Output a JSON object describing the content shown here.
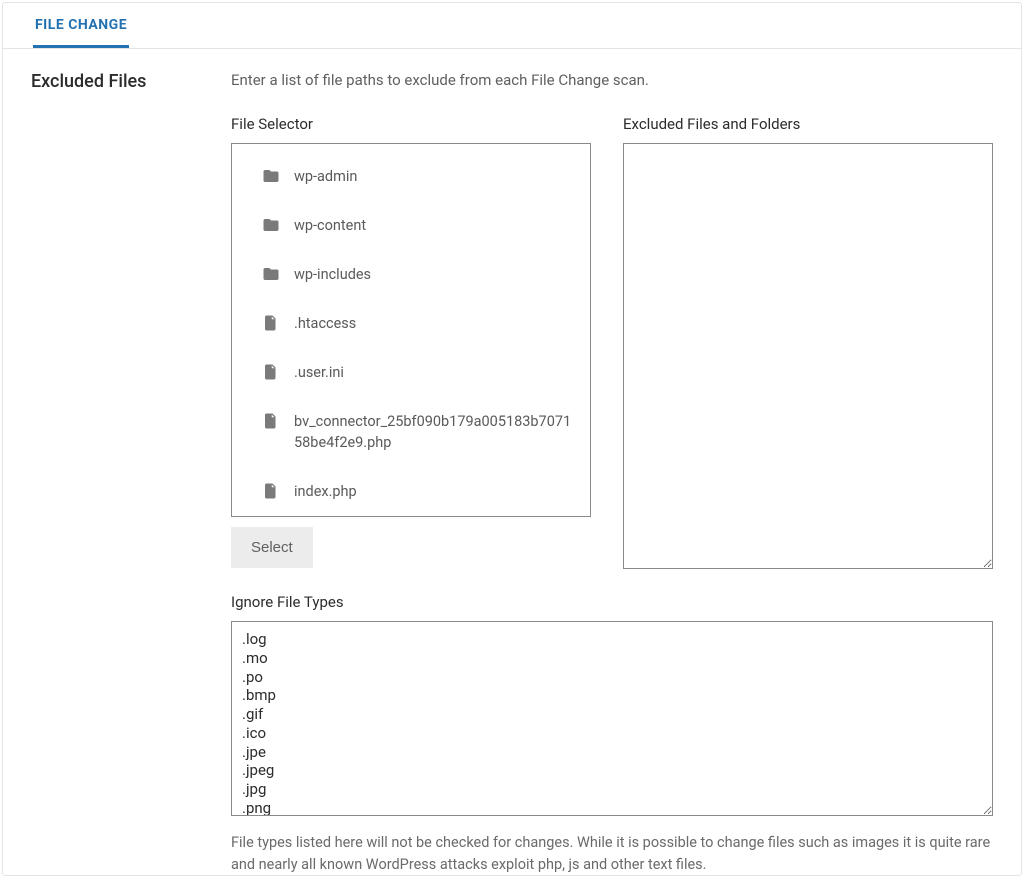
{
  "tab": {
    "label": "FILE CHANGE"
  },
  "section": {
    "title": "Excluded Files",
    "description": "Enter a list of file paths to exclude from each File Change scan."
  },
  "file_selector": {
    "label": "File Selector",
    "items": [
      {
        "type": "folder",
        "name": "wp-admin"
      },
      {
        "type": "folder",
        "name": "wp-content"
      },
      {
        "type": "folder",
        "name": "wp-includes"
      },
      {
        "type": "file",
        "name": ".htaccess"
      },
      {
        "type": "file",
        "name": ".user.ini"
      },
      {
        "type": "file",
        "name": "bv_connector_25bf090b179a005183b707158be4f2e9.php"
      },
      {
        "type": "file",
        "name": "index.php"
      }
    ],
    "select_button": "Select"
  },
  "excluded": {
    "label": "Excluded Files and Folders",
    "value": ""
  },
  "ignore": {
    "label": "Ignore File Types",
    "value": ".log\n.mo\n.po\n.bmp\n.gif\n.ico\n.jpe\n.jpeg\n.jpg\n.png",
    "help": "File types listed here will not be checked for changes. While it is possible to change files such as images it is quite rare and nearly all known WordPress attacks exploit php, js and other text files."
  }
}
